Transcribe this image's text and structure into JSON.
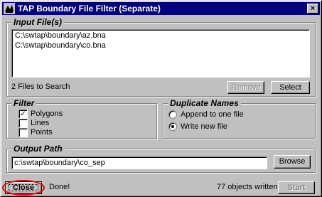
{
  "window": {
    "title": "TAP Boundary File Filter (Separate)",
    "close_glyph": "×",
    "app_icon": "tap-app-icon"
  },
  "input_files": {
    "title": "Input File(s)",
    "files": [
      "C:\\swtap\\boundary\\az.bna",
      "C:\\swtap\\boundary\\co.bna"
    ],
    "status": "2 Files to Search",
    "remove_label": "Remove",
    "select_label": "Select"
  },
  "filter": {
    "title": "Filter",
    "options": [
      {
        "label": "Polygons",
        "checked": true
      },
      {
        "label": "Lines",
        "checked": false
      },
      {
        "label": "Points",
        "checked": false
      }
    ]
  },
  "duplicate_names": {
    "title": "Duplicate Names",
    "options": [
      {
        "label": "Append to one file",
        "selected": false
      },
      {
        "label": "Write new file",
        "selected": true
      }
    ]
  },
  "output_path": {
    "title": "Output Path",
    "value": "c:\\swtap\\boundary\\co_sep",
    "browse_label": "Browse"
  },
  "footer": {
    "close_label": "Close",
    "done_text": "Done!",
    "objects_written": "77 objects written",
    "start_label": "Start"
  },
  "colors": {
    "titlebar": "#000080",
    "annotation_ellipse": "#e00000"
  }
}
